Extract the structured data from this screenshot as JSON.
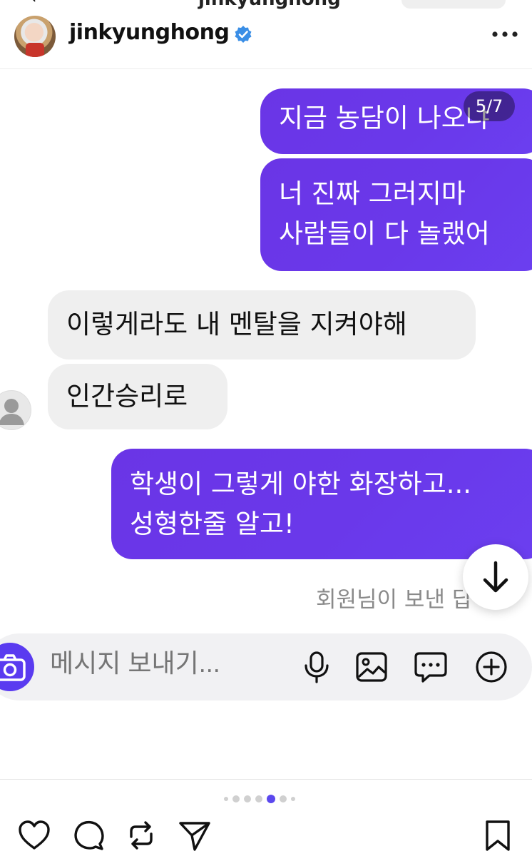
{
  "top": {
    "cut_title": "jinkyunghong"
  },
  "post": {
    "username": "jinkyunghong"
  },
  "carousel": {
    "counter": "5/7",
    "current": 5,
    "total": 7
  },
  "chat": {
    "messages": [
      {
        "direction": "sent",
        "text": "지금 농담이 나오냐"
      },
      {
        "direction": "sent",
        "text": "너 진짜 그러지마\n사람들이 다 놀랬어"
      },
      {
        "direction": "received",
        "text": "이렇게라도 내 멘탈을 지켜야해"
      },
      {
        "direction": "received",
        "text": "인간승리로"
      },
      {
        "direction": "sent",
        "text": "학생이 그렇게 야한 화장하고...\n성형한줄 알고!"
      }
    ],
    "seen_text": "회원님이 보낸 답"
  },
  "composer": {
    "placeholder": "메시지 보내기..."
  },
  "colors": {
    "sent_bubble": "#6a38ea",
    "received_bubble": "#efefef",
    "accent": "#5b48ee",
    "verified": "#3a8ee6"
  },
  "icons": [
    "verified-icon",
    "more-icon",
    "camera-icon",
    "mic-icon",
    "image-icon",
    "sticker-icon",
    "plus-icon",
    "arrow-down-icon",
    "heart-icon",
    "comment-icon",
    "repost-icon",
    "share-icon",
    "bookmark-icon"
  ]
}
